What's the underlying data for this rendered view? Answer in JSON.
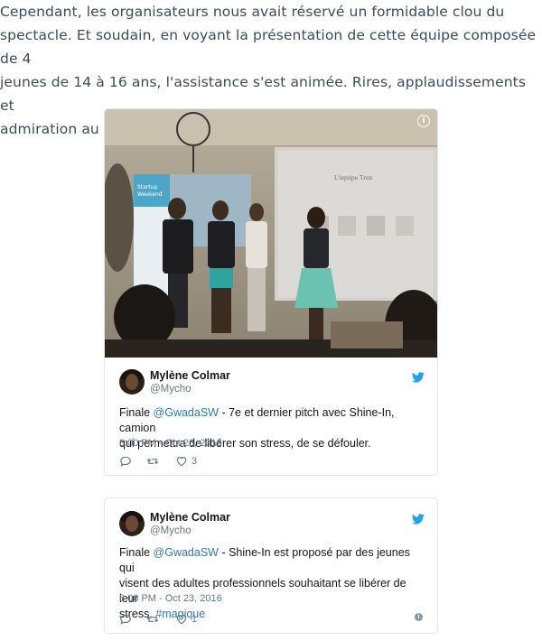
{
  "intro": {
    "line1": "Cependant, les organisateurs nous avait réservé un formidable clou du",
    "line2": "spectacle. Et soudain, en voyant la présentation de cette équipe composée de 4",
    "line3": "jeunes de 14 à 16 ans, l'assistance s'est animée. Rires, applaudissements et",
    "line4": "admiration au rendez-vous !"
  },
  "tweets": [
    {
      "name": "Mylène Colmar",
      "handle": "@Mycho",
      "mention": "@GwadaSW",
      "text_before": "Finale ",
      "text_line1_after": " - 7e et dernier pitch avec Shine-In, camion",
      "text_line2": "qui permettra de libérer son stress, de se défouler.",
      "timestamp": "8:00 PM - Oct 23, 2016",
      "like_count": "3",
      "photo_slide_title": "L'équipe Tren",
      "photo_banner_line1": "Startup",
      "photo_banner_line2": "Weekend"
    },
    {
      "name": "Mylène Colmar",
      "handle": "@Mycho",
      "mention": "@GwadaSW",
      "text_before": "Finale ",
      "text_line1_after": " - Shine-In est proposé par des jeunes qui",
      "text_line2": "visent des adultes professionnels souhaitant se libérer de leur",
      "text_line3_before": "stress. ",
      "hashtag": "#magique",
      "timestamp": "8:06 PM - Oct 23, 2016",
      "like_count": "1"
    }
  ],
  "icons": {
    "bird": "twitter-bird-icon",
    "reply": "reply-icon",
    "retweet": "retweet-icon",
    "like": "heart-icon",
    "info": "info-icon"
  },
  "colors": {
    "body_text": "#3b4c5c",
    "link": "#2b7bb9",
    "bird": "#1da1f2",
    "meta": "#657786",
    "border": "#e1e8ed"
  }
}
